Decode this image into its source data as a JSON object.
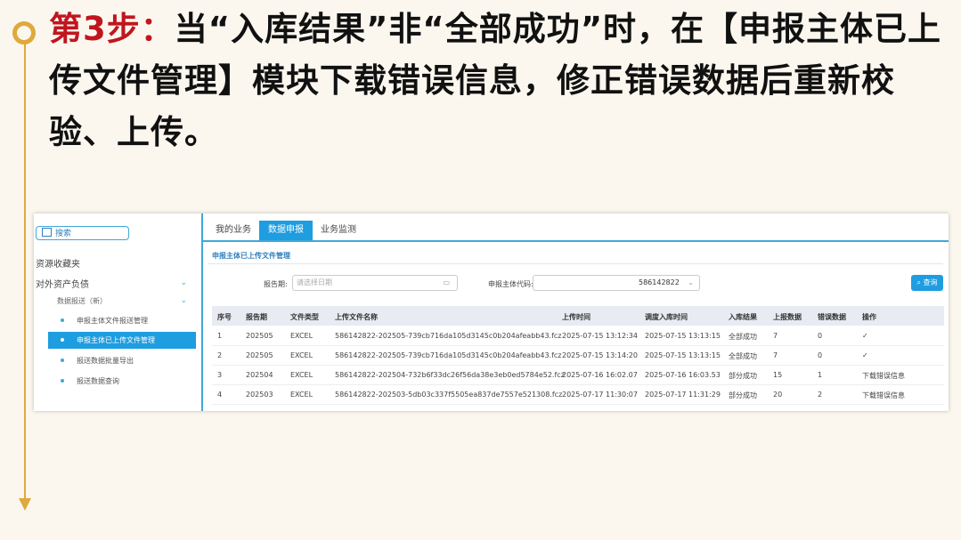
{
  "heading": {
    "step": "第3步：",
    "text": "当“入库结果”非“全部成功”时，在【申报主体已上传文件管理】模块下载错误信息，修正错误数据后重新校验、上传。"
  },
  "sidebar": {
    "search": "搜索",
    "section1": "资源收藏夹",
    "section2": "对外资产负债",
    "subgroup": "数据报送（新）",
    "items": [
      {
        "label": "申报主体文件报送管理"
      },
      {
        "label": "申报主体已上传文件管理"
      },
      {
        "label": "报送数据批量导出"
      },
      {
        "label": "报送数据查询"
      }
    ]
  },
  "tabs": [
    {
      "label": "我的业务"
    },
    {
      "label": "数据申报"
    },
    {
      "label": "业务监测"
    }
  ],
  "breadcrumb": "申报主体已上传文件管理",
  "filters": {
    "period_label": "报告期:",
    "period_placeholder": "请选择日期",
    "entity_label": "申报主体代码:",
    "entity_value": "586142822",
    "query_button": "查询"
  },
  "table": {
    "columns": [
      "序号",
      "报告期",
      "文件类型",
      "上传文件名称",
      "上传时间",
      "调度入库时间",
      "入库结果",
      "上报数据",
      "错误数据",
      "操作"
    ],
    "rows": [
      [
        "1",
        "202505",
        "EXCEL",
        "586142822-202505-739cb716da105d3145c0b204afeabb43.fcz",
        "2025-07-15 13:12:34",
        "2025-07-15 13:13:15",
        "全部成功",
        "7",
        "0",
        "✓"
      ],
      [
        "2",
        "202505",
        "EXCEL",
        "586142822-202505-739cb716da105d3145c0b204afeabb43.fcz",
        "2025-07-15 13:14:20",
        "2025-07-15 13:13:15",
        "全部成功",
        "7",
        "0",
        "✓"
      ],
      [
        "3",
        "202504",
        "EXCEL",
        "586142822-202504-732b6f33dc26f56da38e3eb0ed5784e52.fcz",
        "2025-07-16 16:02.07",
        "2025-07-16 16:03.53",
        "部分成功",
        "15",
        "1",
        "下载错误信息"
      ],
      [
        "4",
        "202503",
        "EXCEL",
        "586142822-202503-5db03c337f5505ea837de7557e521308.fcz",
        "2025-07-17 11:30:07",
        "2025-07-17 11:31:29",
        "部分成功",
        "20",
        "2",
        "下载错误信息"
      ]
    ]
  }
}
